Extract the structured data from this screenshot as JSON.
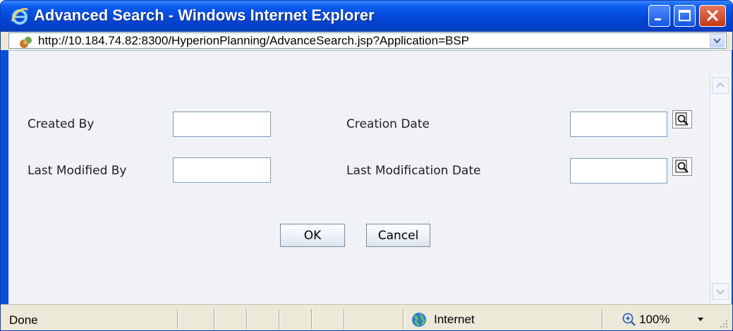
{
  "window": {
    "title": "Advanced Search - Windows Internet Explorer",
    "icon": "ie-logo-icon",
    "controls": [
      "minimize",
      "maximize",
      "close"
    ]
  },
  "address_bar": {
    "url": "http://10.184.74.82:8300/HyperionPlanning/AdvanceSearch.jsp?Application=BSP",
    "page_icon": "page-icon",
    "dropdown_icon": "chevron-down-icon"
  },
  "form": {
    "created_by": {
      "label": "Created By",
      "value": ""
    },
    "creation_date": {
      "label": "Creation Date",
      "value": "",
      "picker_icon": "date-picker-icon"
    },
    "last_modified_by": {
      "label": "Last Modified By",
      "value": ""
    },
    "last_modification_date": {
      "label": "Last Modification Date",
      "value": "",
      "picker_icon": "date-picker-icon"
    },
    "ok_label": "OK",
    "cancel_label": "Cancel"
  },
  "status_bar": {
    "status": "Done",
    "zone": "Internet",
    "zone_icon": "globe-icon",
    "zoom": "100%",
    "zoom_icon": "magnifier-icon"
  },
  "colors": {
    "titlebar": "#0347d6",
    "content_background": "#f0f2f6",
    "chrome": "#ece9d8",
    "close_button": "#c53a17"
  }
}
